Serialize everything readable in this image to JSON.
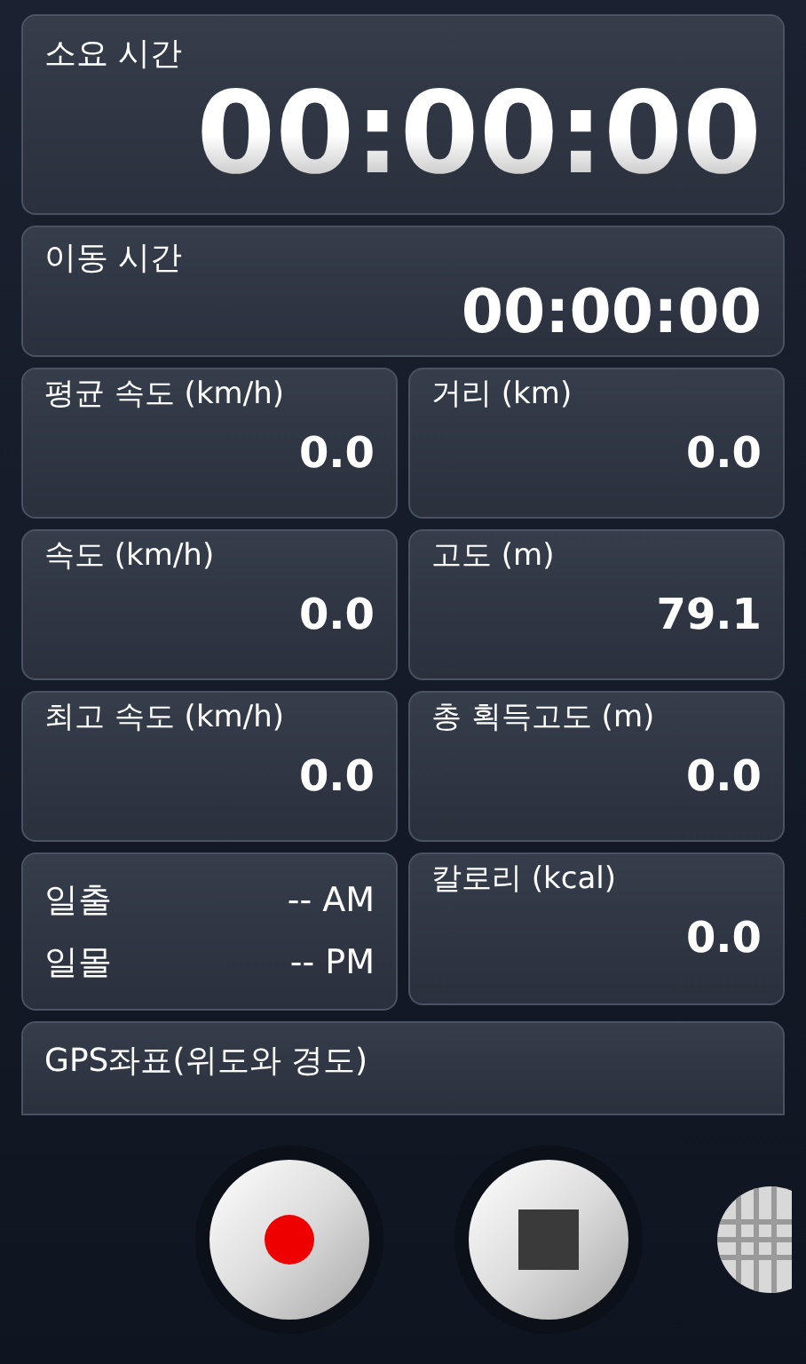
{
  "elapsed": {
    "label": "소요 시간",
    "value": "00:00:00"
  },
  "moving": {
    "label": "이동 시간",
    "value": "00:00:00"
  },
  "metrics": [
    {
      "label": "평균 속도 (km/h)",
      "value": "0.0"
    },
    {
      "label": "거리 (km)",
      "value": "0.0"
    },
    {
      "label": "속도 (km/h)",
      "value": "0.0"
    },
    {
      "label": "고도 (m)",
      "value": "79.1"
    },
    {
      "label": "최고 속도 (km/h)",
      "value": "0.0"
    },
    {
      "label": "총 획득고도 (m)",
      "value": "0.0"
    }
  ],
  "sun": [
    {
      "label": "일출",
      "value": "-- AM"
    },
    {
      "label": "일몰",
      "value": "-- PM"
    }
  ],
  "calories": {
    "label": "칼로리 (kcal)",
    "value": "0.0"
  },
  "gps": {
    "label": "GPS좌표(위도와 경도)"
  }
}
